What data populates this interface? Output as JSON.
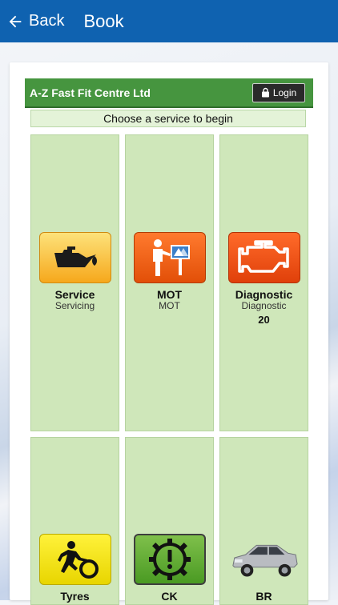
{
  "appbar": {
    "back_label": "Back",
    "title": "Book"
  },
  "header": {
    "company": "A-Z Fast Fit Centre Ltd",
    "login_label": "Login"
  },
  "prompt": "Choose a service to begin",
  "services": [
    {
      "name": "Service",
      "subtitle": "Servicing",
      "icon": "oil-can-icon"
    },
    {
      "name": "MOT",
      "subtitle": "MOT",
      "icon": "mot-inspector-icon"
    },
    {
      "name": "Diagnostic",
      "subtitle": "Diagnostic",
      "price": "20",
      "icon": "engine-warning-icon"
    },
    {
      "name": "Tyres",
      "icon": "tyre-runner-icon"
    },
    {
      "name": "CK",
      "icon": "gear-warning-icon"
    },
    {
      "name": "BR",
      "icon": "car-icon"
    }
  ],
  "colors": {
    "appbar": "#0f62b0",
    "header_green": "#46953f",
    "tile_green": "#cfe7ba",
    "prompt_bg": "#e4f3d8"
  }
}
